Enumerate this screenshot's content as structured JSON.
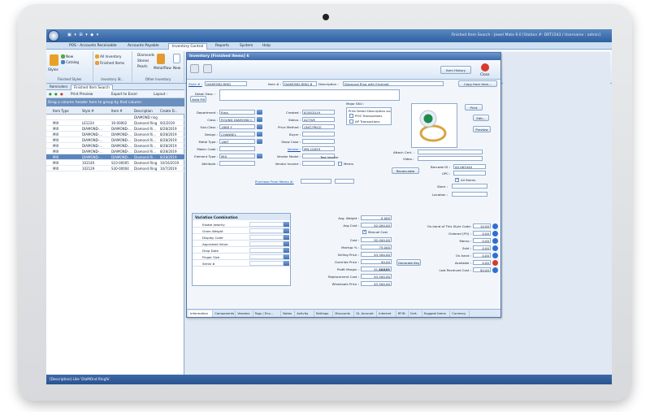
{
  "app": {
    "title": "Finished Item Search - Jewel Mate 9.0 [Station #: DRT1543 / Username : admin]"
  },
  "ribbon": {
    "tabs": [
      "POS - Accounts Receivable",
      "Accounts Payable",
      "Inventory Control",
      "Reports",
      "System",
      "Help"
    ],
    "active_tab": "Inventory Control",
    "items": {
      "new": "New",
      "all_inventory": "All Inventory",
      "diamonds": "Diamonds",
      "stones": "Stones",
      "pearls": "Pearls",
      "metal_raw": "Metal/Raw",
      "new2": "New",
      "styles": "Styles",
      "catalog": "Catalog",
      "finished_items": "Finished Items"
    },
    "groups": {
      "finished_styles": "Finished Styles",
      "inventory_st": "Inventory St...",
      "other_inventory": "Other Inventory"
    }
  },
  "left_panel": {
    "tabs": [
      "Reminders",
      "Finished Item Search"
    ],
    "toolbar": {
      "print_preview": "Print Preview",
      "export_excel": "Export to Excel",
      "layout": "Layout :"
    },
    "group_header": "Drag a column header here to group by that column",
    "columns": [
      "Item Type",
      "Style #",
      "Item #",
      "Description",
      "Create D..."
    ],
    "rows": [
      [
        "",
        "",
        "",
        "DIAMOND ring",
        ""
      ],
      [
        "MIX",
        "LE1224",
        "30-00002",
        "Diamond Ring",
        "9/2/2019"
      ],
      [
        "MIX",
        "DIAMOND-...",
        "DIAMOND-...",
        "Diamond Ri...",
        "8/28/2019"
      ],
      [
        "MIX",
        "DIAMOND-...",
        "DIAMOND-...",
        "Diamond Ri...",
        "8/28/2019"
      ],
      [
        "MIX",
        "DIAMOND-...",
        "DIAMOND-...",
        "Diamond Ri...",
        "8/28/2019"
      ],
      [
        "MIX",
        "DIAMOND-...",
        "DIAMOND-...",
        "Diamond Ri...",
        "8/28/2019"
      ],
      [
        "MIX",
        "DIAMOND-...",
        "DIAMOND-...",
        "Diamond Ri...",
        "8/28/2019"
      ],
      [
        "MIX",
        "DIAMOND-...",
        "DIAMOND-...",
        "Diamond Ri...",
        "8/28/2019"
      ],
      [
        "MIX",
        "102140",
        "S10-00005",
        "Diamond Ring",
        "10/16/2019"
      ],
      [
        "MIX",
        "102129",
        "S30-00004",
        "Diamond Ring",
        "10/7/2019"
      ]
    ],
    "selected_row": 7
  },
  "status": {
    "filter": "[Description] Like 'DIaMOnd Ring%'"
  },
  "window": {
    "title": "Inventory [Finished Items] 6",
    "item_history": "Item History",
    "close": "Close",
    "style_label": "Style # :",
    "style_value": "DIAMOND-RING",
    "item_label": "Item # :",
    "item_value": "DIAMOND-RING-8",
    "desc_label": "Description :",
    "desc_value": "Diamond Ring with Emerald",
    "copy_from_item": "Copy from Item...",
    "detail_desc": "Detail Desc :",
    "auto_fill": "Auto Fill",
    "fields": [
      {
        "label": "Department :",
        "value": "Ring"
      },
      {
        "label": "Class :",
        "value": "ROUND DIAMOND C"
      },
      {
        "label": "Sub-Class :",
        "value": "18KR Y"
      },
      {
        "label": "Design :",
        "value": "CHANNEL"
      },
      {
        "label": "Metal Type :",
        "value": "18KT"
      },
      {
        "label": "Maker Code :",
        "value": ""
      },
      {
        "label": "Element Type :",
        "value": "MIX"
      },
      {
        "label": "Attribute :",
        "value": ""
      }
    ],
    "mid_fields": [
      {
        "label": "Created :",
        "value": "8/28/2019"
      },
      {
        "label": "Status :",
        "value": "ACTIVE"
      },
      {
        "label": "Price Method :",
        "value": "UNIT-PRICE"
      },
      {
        "label": "Buyer :",
        "value": ""
      },
      {
        "label": "Show Case :",
        "value": ""
      },
      {
        "label": "Vendor :",
        "value": "MN-10059"
      },
      {
        "label": "Vendor Model :",
        "value": ""
      },
      {
        "label": "Vendor Invoice :",
        "value": ""
      }
    ],
    "vendor_name": "Test Vendor",
    "memo": "Memo",
    "purchase_from_memo": "Purchase From Memo #:",
    "major_sku": "Major SKU :",
    "print_detail": "Print Detail Description on:",
    "pos_transactions": "POS Transactions",
    "ap_transactions": "AP Transactions",
    "print": "Print",
    "edit": "Edit...",
    "preview": "Preview",
    "attach_cert": "Attach Cert. :",
    "video": "Video :",
    "barcode_id": "Barcode ID :",
    "barcode_value": "00 063440",
    "upc": "UPC :",
    "all_stores": "All Stores",
    "store": "Store :",
    "location": "Location :",
    "recalculate": "Recalculate",
    "variation": {
      "title": "Variation Combination",
      "rows": [
        "Estate Jewelry",
        "Gram Weight",
        "Display Code",
        "Appraised Value",
        "Drop Date",
        "Finger Size",
        "Serial #"
      ]
    },
    "pricing": [
      {
        "label": "Avg. Weight :",
        "value": "0.000"
      },
      {
        "label": "Avg Cost :",
        "value": "$2,000.00"
      },
      {
        "label": "",
        "value": ""
      },
      {
        "label": "Cost :",
        "value": "$2,000.00"
      },
      {
        "label": "Markup % :",
        "value": "75.000"
      },
      {
        "label": "Selling Price :",
        "value": "$3,500.00"
      },
      {
        "label": "Override Price :",
        "value": "$0.00"
      },
      {
        "label": "Profit Margin :",
        "value": "$1,500.00"
      },
      {
        "label": "Replacement Cost :",
        "value": "$3,500.00"
      },
      {
        "label": "Wholesale Price :",
        "value": "$3,500.00"
      }
    ],
    "manual_cost": "Manual Cost",
    "generate_key": "Generate Key",
    "margin_pct": "42.857",
    "onhand": [
      {
        "label": "On-hand of This Style Code:",
        "value": "10.00"
      },
      {
        "label": "Ordered (PO) :",
        "value": "0.00"
      },
      {
        "label": "Memo :",
        "value": "0.00"
      },
      {
        "label": "Sold :",
        "value": "0.00"
      },
      {
        "label": "On-hand :",
        "value": "0.00"
      },
      {
        "label": "Available :",
        "value": "0.00"
      },
      {
        "label": "Last Received Cost :",
        "value": "$0.00"
      }
    ],
    "bottom_tabs": [
      "Information",
      "Components",
      "Vendors",
      "Tags / Env...",
      "Notes",
      "Activity",
      "Settings",
      "Discounts",
      "GL Account",
      "Internet",
      "RFID",
      "Cert.",
      "Suggest Items",
      "Currency"
    ],
    "active_bottom_tab": "Information"
  }
}
